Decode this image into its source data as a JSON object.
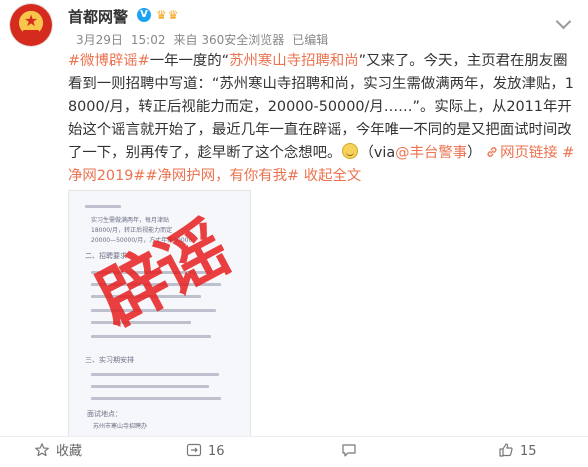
{
  "header": {
    "name": "首都网警",
    "verified_mark": "V",
    "badges": "♛♛",
    "date": "3月29日",
    "time": "15:02",
    "source": "来自 360安全浏览器",
    "edited": "已编辑"
  },
  "post": {
    "hashtag1": "#微博辟谣#",
    "p1": "一年一度的“",
    "quote_hl": "苏州寒山寺招聘和尚",
    "p2": "”又来了。今天，主页君在朋友圈看到一则招聘中写道：“苏州寒山寺招聘和尚，实习生需做满两年，发放津贴，18000/月，转正后视能力而定，20000-50000/月……”。实际上，从2011年开始这个谣言就开始了，最近几年一直在辟谣，今年唯一不同的是又把面试时间改了一下，别再传了，趁早断了这个念想吧。",
    "via_prefix": "（via",
    "via_user": "@丰台警事",
    "via_suffix": "）",
    "weblink": "网页链接",
    "hashtag2": "#净网2019#",
    "hashtag3": "#净网护网，有你有我#",
    "collapse": "收起全文"
  },
  "image": {
    "stamp": "辟谣",
    "lines": [
      "实习生需做满两年，每月津贴",
      "18000/月，转正后视能力而定",
      "20000—50000/月，方丈年薪80000",
      "二、招聘要求",
      "三、实习期安排",
      "面试地点：",
      "苏州市寒山寺招聘办"
    ]
  },
  "footer": {
    "collect": "收藏",
    "repost_count": "16",
    "comment_count": "",
    "like_count": "15"
  },
  "colors": {
    "accent": "#eb7350",
    "verified": "#1da1f2",
    "stamp": "#e61e1e"
  }
}
